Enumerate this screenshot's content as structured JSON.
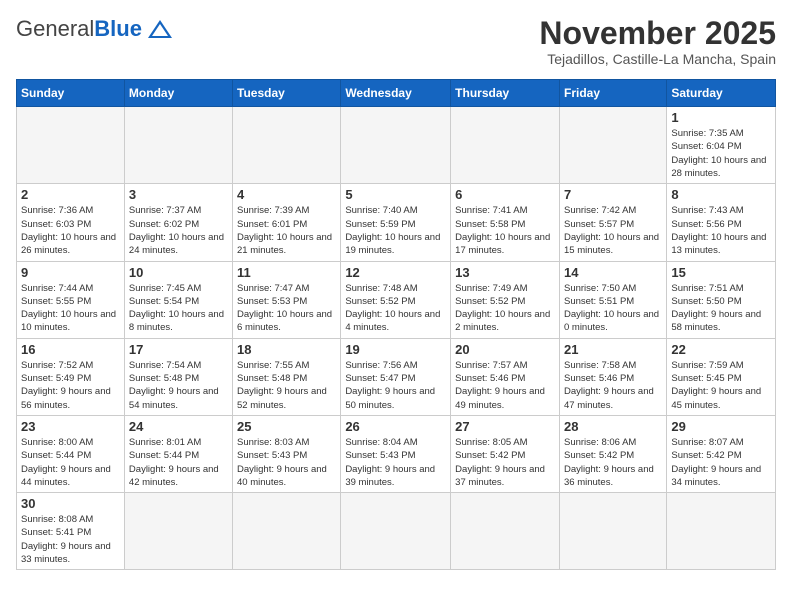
{
  "header": {
    "logo_general": "General",
    "logo_blue": "Blue",
    "month_title": "November 2025",
    "location": "Tejadillos, Castille-La Mancha, Spain"
  },
  "weekdays": [
    "Sunday",
    "Monday",
    "Tuesday",
    "Wednesday",
    "Thursday",
    "Friday",
    "Saturday"
  ],
  "days": [
    {
      "num": "",
      "info": ""
    },
    {
      "num": "",
      "info": ""
    },
    {
      "num": "",
      "info": ""
    },
    {
      "num": "",
      "info": ""
    },
    {
      "num": "",
      "info": ""
    },
    {
      "num": "",
      "info": ""
    },
    {
      "num": "1",
      "info": "Sunrise: 7:35 AM\nSunset: 6:04 PM\nDaylight: 10 hours and 28 minutes."
    },
    {
      "num": "2",
      "info": "Sunrise: 7:36 AM\nSunset: 6:03 PM\nDaylight: 10 hours and 26 minutes."
    },
    {
      "num": "3",
      "info": "Sunrise: 7:37 AM\nSunset: 6:02 PM\nDaylight: 10 hours and 24 minutes."
    },
    {
      "num": "4",
      "info": "Sunrise: 7:39 AM\nSunset: 6:01 PM\nDaylight: 10 hours and 21 minutes."
    },
    {
      "num": "5",
      "info": "Sunrise: 7:40 AM\nSunset: 5:59 PM\nDaylight: 10 hours and 19 minutes."
    },
    {
      "num": "6",
      "info": "Sunrise: 7:41 AM\nSunset: 5:58 PM\nDaylight: 10 hours and 17 minutes."
    },
    {
      "num": "7",
      "info": "Sunrise: 7:42 AM\nSunset: 5:57 PM\nDaylight: 10 hours and 15 minutes."
    },
    {
      "num": "8",
      "info": "Sunrise: 7:43 AM\nSunset: 5:56 PM\nDaylight: 10 hours and 13 minutes."
    },
    {
      "num": "9",
      "info": "Sunrise: 7:44 AM\nSunset: 5:55 PM\nDaylight: 10 hours and 10 minutes."
    },
    {
      "num": "10",
      "info": "Sunrise: 7:45 AM\nSunset: 5:54 PM\nDaylight: 10 hours and 8 minutes."
    },
    {
      "num": "11",
      "info": "Sunrise: 7:47 AM\nSunset: 5:53 PM\nDaylight: 10 hours and 6 minutes."
    },
    {
      "num": "12",
      "info": "Sunrise: 7:48 AM\nSunset: 5:52 PM\nDaylight: 10 hours and 4 minutes."
    },
    {
      "num": "13",
      "info": "Sunrise: 7:49 AM\nSunset: 5:52 PM\nDaylight: 10 hours and 2 minutes."
    },
    {
      "num": "14",
      "info": "Sunrise: 7:50 AM\nSunset: 5:51 PM\nDaylight: 10 hours and 0 minutes."
    },
    {
      "num": "15",
      "info": "Sunrise: 7:51 AM\nSunset: 5:50 PM\nDaylight: 9 hours and 58 minutes."
    },
    {
      "num": "16",
      "info": "Sunrise: 7:52 AM\nSunset: 5:49 PM\nDaylight: 9 hours and 56 minutes."
    },
    {
      "num": "17",
      "info": "Sunrise: 7:54 AM\nSunset: 5:48 PM\nDaylight: 9 hours and 54 minutes."
    },
    {
      "num": "18",
      "info": "Sunrise: 7:55 AM\nSunset: 5:48 PM\nDaylight: 9 hours and 52 minutes."
    },
    {
      "num": "19",
      "info": "Sunrise: 7:56 AM\nSunset: 5:47 PM\nDaylight: 9 hours and 50 minutes."
    },
    {
      "num": "20",
      "info": "Sunrise: 7:57 AM\nSunset: 5:46 PM\nDaylight: 9 hours and 49 minutes."
    },
    {
      "num": "21",
      "info": "Sunrise: 7:58 AM\nSunset: 5:46 PM\nDaylight: 9 hours and 47 minutes."
    },
    {
      "num": "22",
      "info": "Sunrise: 7:59 AM\nSunset: 5:45 PM\nDaylight: 9 hours and 45 minutes."
    },
    {
      "num": "23",
      "info": "Sunrise: 8:00 AM\nSunset: 5:44 PM\nDaylight: 9 hours and 44 minutes."
    },
    {
      "num": "24",
      "info": "Sunrise: 8:01 AM\nSunset: 5:44 PM\nDaylight: 9 hours and 42 minutes."
    },
    {
      "num": "25",
      "info": "Sunrise: 8:03 AM\nSunset: 5:43 PM\nDaylight: 9 hours and 40 minutes."
    },
    {
      "num": "26",
      "info": "Sunrise: 8:04 AM\nSunset: 5:43 PM\nDaylight: 9 hours and 39 minutes."
    },
    {
      "num": "27",
      "info": "Sunrise: 8:05 AM\nSunset: 5:42 PM\nDaylight: 9 hours and 37 minutes."
    },
    {
      "num": "28",
      "info": "Sunrise: 8:06 AM\nSunset: 5:42 PM\nDaylight: 9 hours and 36 minutes."
    },
    {
      "num": "29",
      "info": "Sunrise: 8:07 AM\nSunset: 5:42 PM\nDaylight: 9 hours and 34 minutes."
    },
    {
      "num": "30",
      "info": "Sunrise: 8:08 AM\nSunset: 5:41 PM\nDaylight: 9 hours and 33 minutes."
    },
    {
      "num": "",
      "info": ""
    },
    {
      "num": "",
      "info": ""
    },
    {
      "num": "",
      "info": ""
    },
    {
      "num": "",
      "info": ""
    },
    {
      "num": "",
      "info": ""
    },
    {
      "num": "",
      "info": ""
    }
  ]
}
